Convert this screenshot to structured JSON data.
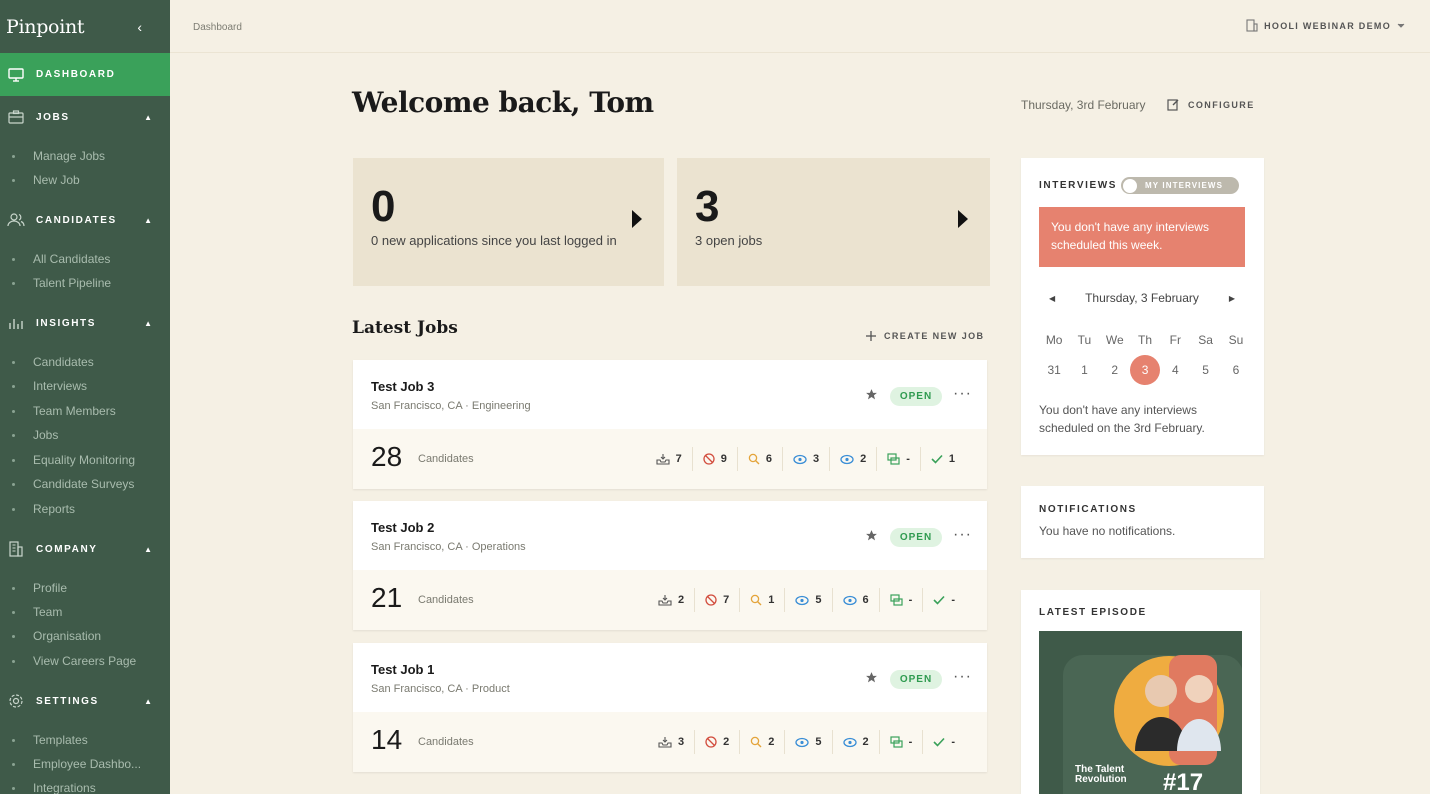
{
  "sidebar": {
    "brand": "Pinpoint",
    "collapse_glyph": "‹",
    "dashboard": "DASHBOARD",
    "jobs": {
      "label": "JOBS",
      "items": [
        "Manage Jobs",
        "New Job"
      ]
    },
    "candidates": {
      "label": "CANDIDATES",
      "items": [
        "All Candidates",
        "Talent Pipeline"
      ]
    },
    "insights": {
      "label": "INSIGHTS",
      "items": [
        "Candidates",
        "Interviews",
        "Team Members",
        "Jobs",
        "Equality Monitoring",
        "Candidate Surveys",
        "Reports"
      ]
    },
    "company": {
      "label": "COMPANY",
      "items": [
        "Profile",
        "Team",
        "Organisation",
        "View Careers Page"
      ]
    },
    "settings": {
      "label": "SETTINGS",
      "items": [
        "Templates",
        "Employee Dashbo...",
        "Integrations"
      ]
    },
    "caret_glyph": "▲"
  },
  "topbar": {
    "breadcrumb": "Dashboard",
    "org": "HOOLI WEBINAR DEMO"
  },
  "header": {
    "welcome": "Welcome back, Tom",
    "date": "Thursday, 3rd February",
    "configure": "CONFIGURE"
  },
  "stats": [
    {
      "value": "0",
      "label": "0 new applications since you last logged in"
    },
    {
      "value": "3",
      "label": "3 open jobs"
    }
  ],
  "latest_jobs": {
    "title": "Latest Jobs",
    "create": "CREATE NEW JOB",
    "candidates_label": "Candidates",
    "jobs": [
      {
        "title": "Test Job 3",
        "location": "San Francisco, CA · Engineering",
        "status": "OPEN",
        "count": "28",
        "m": {
          "inbox": "7",
          "rejected": "9",
          "screening": "6",
          "interview1": "3",
          "interview2": "2",
          "offer": "-",
          "hired": "1"
        }
      },
      {
        "title": "Test Job 2",
        "location": "San Francisco, CA · Operations",
        "status": "OPEN",
        "count": "21",
        "m": {
          "inbox": "2",
          "rejected": "7",
          "screening": "1",
          "interview1": "5",
          "interview2": "6",
          "offer": "-",
          "hired": "-"
        }
      },
      {
        "title": "Test Job 1",
        "location": "San Francisco, CA · Product",
        "status": "OPEN",
        "count": "14",
        "m": {
          "inbox": "3",
          "rejected": "2",
          "screening": "2",
          "interview1": "5",
          "interview2": "2",
          "offer": "-",
          "hired": "-"
        }
      }
    ],
    "more_glyph": "···"
  },
  "interviews": {
    "title": "INTERVIEWS",
    "toggle": "MY INTERVIEWS",
    "alert": "You don't have any interviews scheduled this week.",
    "calendar_date": "Thursday, 3 February",
    "prev": "◀",
    "next": "▶",
    "days": [
      "Mo",
      "Tu",
      "We",
      "Th",
      "Fr",
      "Sa",
      "Su"
    ],
    "dates": [
      "31",
      "1",
      "2",
      "3",
      "4",
      "5",
      "6"
    ],
    "none_today": "You don't have any interviews scheduled on the 3rd February."
  },
  "notifications": {
    "title": "NOTIFICATIONS",
    "text": "You have no notifications."
  },
  "episode": {
    "title": "LATEST EPISODE",
    "show": "The Talent Revolution",
    "number": "#17"
  },
  "colors": {
    "sidebar": "#3f5a49",
    "active": "#3aa15a",
    "accent": "#e6826f",
    "open_badge": "#2f9b50",
    "background": "#f5f0e4"
  }
}
